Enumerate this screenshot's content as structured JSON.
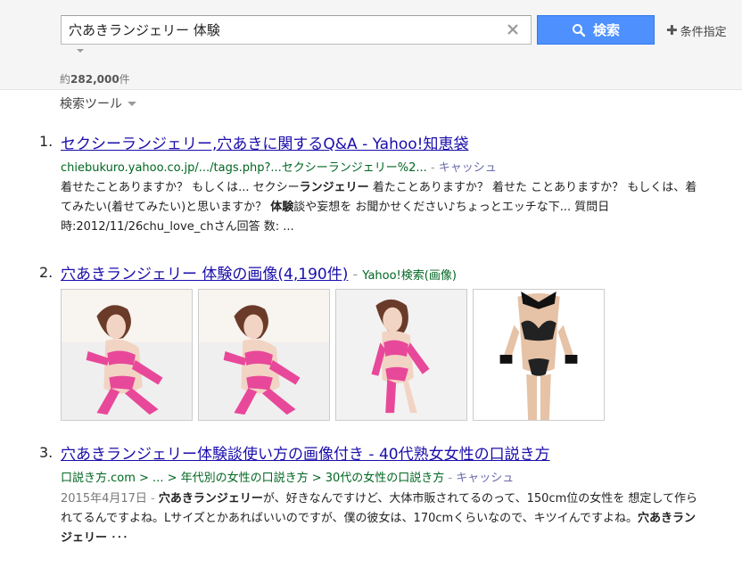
{
  "search": {
    "query": "穴あきランジェリー 体験",
    "button_label": "検索",
    "conditions_label": "条件指定"
  },
  "result_count": {
    "prefix": "約",
    "number": "282,000",
    "suffix": "件"
  },
  "search_tools_label": "検索ツール",
  "results": [
    {
      "num": "1.",
      "title": "セクシーランジェリー,穴あきに関するQ&A - Yahoo!知恵袋",
      "url": "chiebukuro.yahoo.co.jp/.../tags.php?...セクシーランジェリー%2...",
      "cache": "キャッシュ",
      "snippet": [
        {
          "t": "着せたことありますか？ もしくは... セクシー",
          "b": false
        },
        {
          "t": "ランジェリー",
          "b": true
        },
        {
          "t": " 着たことありますか？ 着せた ことありますか？ もしくは、着てみたい(着せてみたい)と思いますか？ ",
          "b": false
        },
        {
          "t": "体験",
          "b": true
        },
        {
          "t": "談や妄想を お聞かせください♪ちょっとエッチな下... 質問日時:2012/11/26chu_love_chさん回答 数: ...",
          "b": false
        }
      ]
    },
    {
      "num": "2.",
      "title": "穴あきランジェリー 体験の画像(4,190件)",
      "source": "Yahoo!検索(画像)"
    },
    {
      "num": "3.",
      "title": "穴あきランジェリー体験談使い方の画像付き - 40代熟女女性の口説き方",
      "url": "口説き方.com > ... > 年代別の女性の口説き方 > 30代の女性の口説き方",
      "cache": "キャッシュ",
      "date": "2015年4月17日",
      "snippet": [
        {
          "t": "穴あきランジェリー",
          "b": true
        },
        {
          "t": "が、好きなんですけど、大体市販されてるのって、150cm位の女性を 想定して作られてるんですよね。Lサイズとかあればいいのですが、僕の彼女は、170cmくらいなので、キツイんですよね。",
          "b": false
        },
        {
          "t": "穴あきランジェリー",
          "b": true
        },
        {
          "t": " ･･･",
          "b": false
        }
      ]
    }
  ],
  "colors": {
    "link": "#1a0dab",
    "url": "#006621",
    "button": "#4d90fe",
    "header_bg": "#f5f5f5"
  }
}
